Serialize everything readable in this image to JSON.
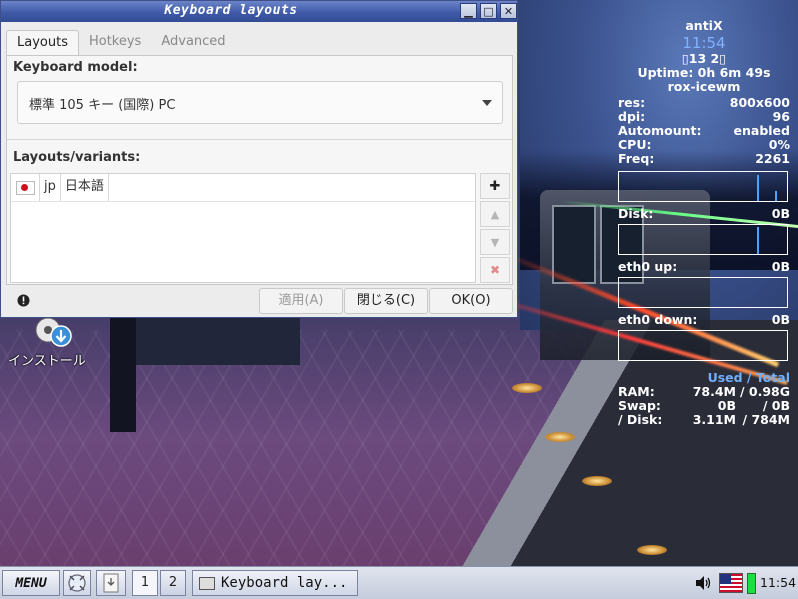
{
  "window": {
    "title": "Keyboard layouts",
    "controls": {
      "minimize": "▁",
      "maximize": "□",
      "close": "✕"
    },
    "tabs": [
      {
        "label": "Layouts",
        "active": true
      },
      {
        "label": "Hotkeys",
        "active": false
      },
      {
        "label": "Advanced",
        "active": false
      }
    ],
    "keyboard_model": {
      "heading": "Keyboard model:",
      "value": "標準 105 キー (国際) PC"
    },
    "layouts": {
      "heading": "Layouts/variants:",
      "rows": [
        {
          "flag": "jp-flag-icon",
          "code": "jp",
          "name": "日本語"
        }
      ]
    },
    "side_buttons": [
      {
        "name": "add-layout-button",
        "glyph": "✚",
        "color": "#222222",
        "enabled": true
      },
      {
        "name": "move-up-button",
        "glyph": "▲",
        "color": "#b5b5b5",
        "enabled": false
      },
      {
        "name": "move-down-button",
        "glyph": "▼",
        "color": "#b5b5b5",
        "enabled": false
      },
      {
        "name": "remove-layout-button",
        "glyph": "✖",
        "color": "#e08a8a",
        "enabled": false
      }
    ],
    "buttons": {
      "apply": "適用(A)",
      "close": "閉じる(C)",
      "ok": "OK(O)"
    }
  },
  "desktop": {
    "install_icon_label": "インストール"
  },
  "conky": {
    "distro": "antiX",
    "time": "11:54",
    "date_line": "▯13 2▯",
    "uptime": "Uptime: 0h 6m 49s",
    "wm": "rox-icewm",
    "stats": [
      {
        "label": "res:",
        "value": "800x600"
      },
      {
        "label": "dpi:",
        "value": "96"
      },
      {
        "label": "Automount:",
        "value": "enabled"
      },
      {
        "label": "CPU:",
        "value": "0%"
      },
      {
        "label": "Freq:",
        "value": "2261"
      }
    ],
    "disk": {
      "label": "Disk:",
      "value": "0B"
    },
    "eth_up": {
      "label": "eth0 up:",
      "value": "0B"
    },
    "eth_down": {
      "label": "eth0 down:",
      "value": "0B"
    },
    "used_total": "Used / Total",
    "memory": [
      {
        "label": "RAM:",
        "used": "78.4M",
        "total": "/ 0.98G"
      },
      {
        "label": "Swap:",
        "used": "0B",
        "total": "/ 0B"
      },
      {
        "label": "/ Disk:",
        "used": "3.11M",
        "total": "/ 784M"
      }
    ]
  },
  "taskbar": {
    "menu_label": "MENU",
    "workspaces": [
      "1",
      "2"
    ],
    "task_label": "Keyboard lay...",
    "clock": "11:54"
  },
  "colors": {
    "titlebar": "#3f5aa8",
    "conky_accent": "#7fb2ff",
    "battery": "#19e040"
  }
}
